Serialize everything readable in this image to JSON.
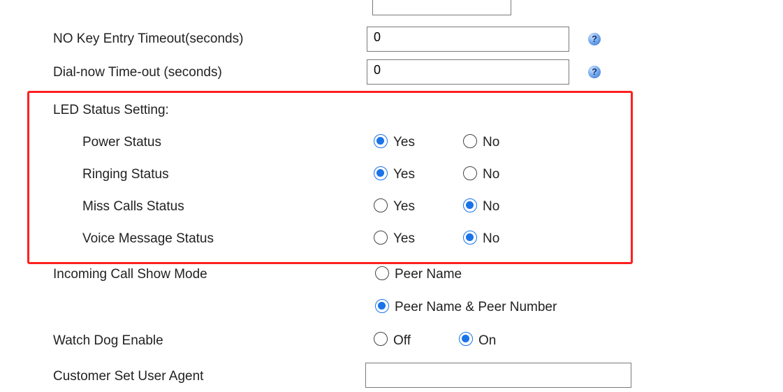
{
  "fields": {
    "no_key_entry_timeout": {
      "label": "NO Key Entry Timeout(seconds)",
      "value": "0",
      "help": "?"
    },
    "dial_now_timeout": {
      "label": "Dial-now Time-out (seconds)",
      "value": "0",
      "help": "?"
    }
  },
  "led": {
    "title": "LED Status Setting:",
    "rows": [
      {
        "label": "Power Status",
        "yes": "Yes",
        "no": "No",
        "selected": "Yes"
      },
      {
        "label": "Ringing Status",
        "yes": "Yes",
        "no": "No",
        "selected": "Yes"
      },
      {
        "label": "Miss Calls Status",
        "yes": "Yes",
        "no": "No",
        "selected": "No"
      },
      {
        "label": "Voice Message Status",
        "yes": "Yes",
        "no": "No",
        "selected": "No"
      }
    ]
  },
  "incoming_call": {
    "label": "Incoming Call Show Mode",
    "options": [
      "Peer Name",
      "Peer Name & Peer Number"
    ],
    "selected": "Peer Name & Peer Number"
  },
  "watch_dog": {
    "label": "Watch Dog Enable",
    "options": [
      "Off",
      "On"
    ],
    "selected": "On"
  },
  "user_agent": {
    "label": "Customer Set User Agent",
    "value": ""
  },
  "colors": {
    "accent": "#1a73e8",
    "highlight_border": "#ff2020",
    "text": "#222222"
  }
}
